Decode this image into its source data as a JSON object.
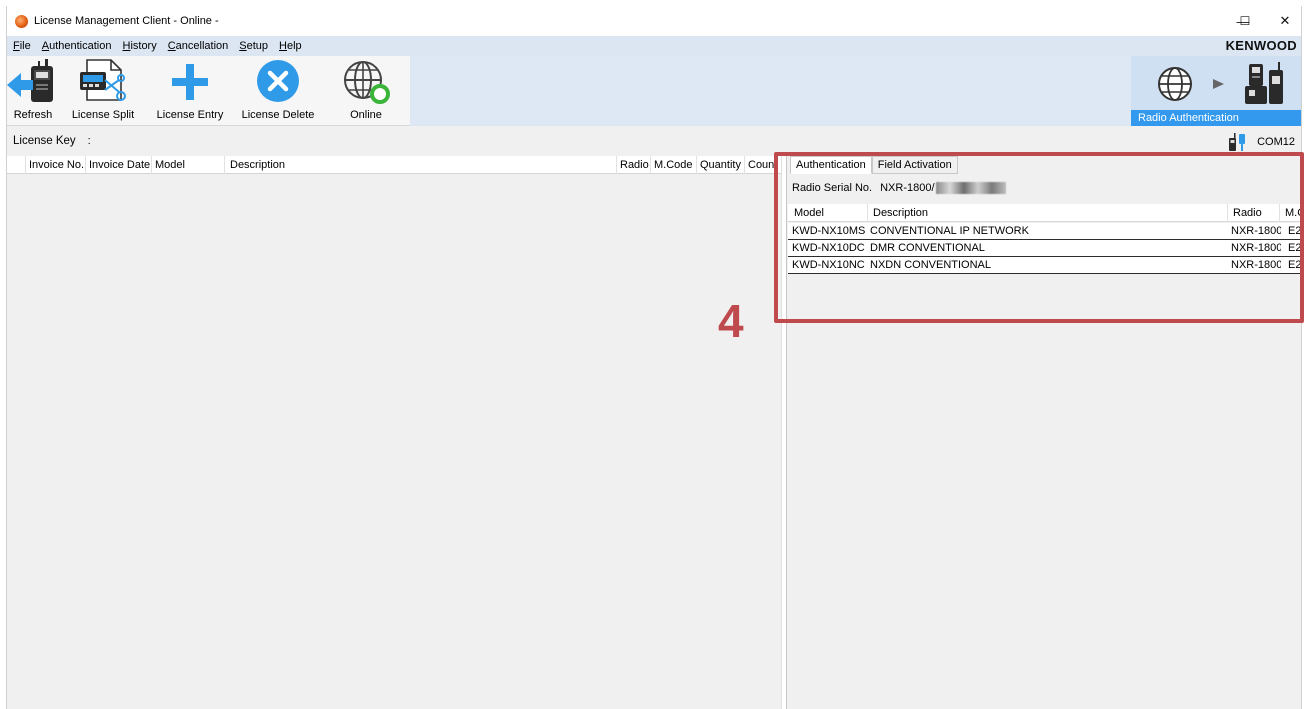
{
  "window": {
    "title": "License Management Client - Online -"
  },
  "window_controls": {
    "minimize": "—",
    "maximize": "☐",
    "close": "✕"
  },
  "menu": {
    "items": [
      {
        "label": "File",
        "key": "F",
        "rest": "ile"
      },
      {
        "label": "Authentication",
        "key": "A",
        "rest": "uthentication"
      },
      {
        "label": "History",
        "key": "H",
        "rest": "istory"
      },
      {
        "label": "Cancellation",
        "key": "C",
        "rest": "ancellation"
      },
      {
        "label": "Setup",
        "key": "S",
        "rest": "etup"
      },
      {
        "label": "Help",
        "key": "H",
        "rest": "elp"
      }
    ],
    "brand": "KENWOOD"
  },
  "toolbar": {
    "refresh": "Refresh",
    "license_split": "License Split",
    "license_entry": "License Entry",
    "license_delete": "License Delete",
    "online": "Online"
  },
  "radio_auth": {
    "label": "Radio Authentication"
  },
  "license_key": {
    "label": "License Key",
    "separator": ":"
  },
  "connection": {
    "port": "COM12"
  },
  "license_table": {
    "columns": [
      "Invoice No.",
      "Invoice Date",
      "Model",
      "Description",
      "Radio",
      "M.Code",
      "Quantity",
      "Coun"
    ]
  },
  "auth_panel": {
    "tabs": [
      "Authentication",
      "Field Activation"
    ],
    "serial_label": "Radio Serial No.",
    "serial_value": "NXR-1800/",
    "columns": [
      "Model",
      "Description",
      "Radio",
      "M.C"
    ],
    "rows": [
      {
        "model": "KWD-NX10MS",
        "description": "CONVENTIONAL IP NETWORK",
        "radio": "NXR-1800",
        "mcode": "E2"
      },
      {
        "model": "KWD-NX10DC",
        "description": "DMR CONVENTIONAL",
        "radio": "NXR-1800",
        "mcode": "E2"
      },
      {
        "model": "KWD-NX10NC",
        "description": "NXDN CONVENTIONAL",
        "radio": "NXR-1800",
        "mcode": "E2"
      }
    ]
  },
  "annotation": {
    "callout": "4"
  },
  "colors": {
    "accent": "#3399ee",
    "highlight": "#bf4a4e",
    "plus": "#2f9be8"
  }
}
